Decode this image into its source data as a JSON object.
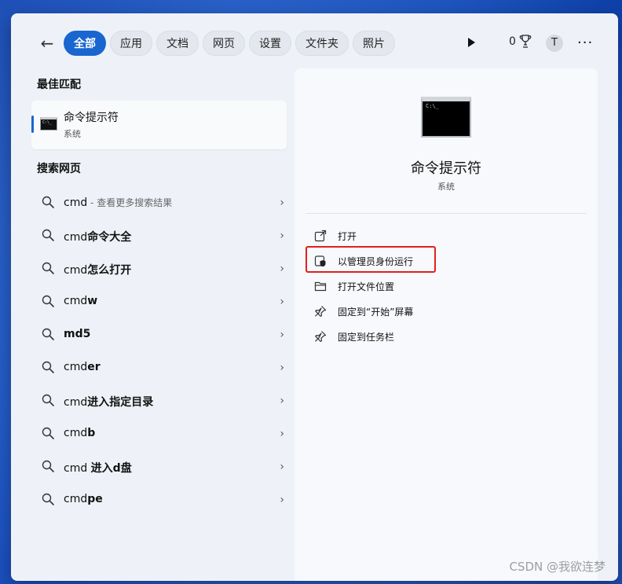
{
  "toolbar": {
    "back_label": "←",
    "filters": [
      "全部",
      "应用",
      "文档",
      "网页",
      "设置",
      "文件夹",
      "照片"
    ],
    "active_filter_index": 0,
    "points": "0",
    "avatar_initial": "T",
    "more_label": "···"
  },
  "best_match": {
    "heading": "最佳匹配",
    "app_name": "命令提示符",
    "app_sub": "系统"
  },
  "web_search": {
    "heading": "搜索网页",
    "results": [
      {
        "plain": "cmd",
        "bold": "",
        "hint": " - 查看更多搜索结果"
      },
      {
        "plain": "cmd",
        "bold": "命令大全",
        "hint": ""
      },
      {
        "plain": "cmd",
        "bold": "怎么打开",
        "hint": ""
      },
      {
        "plain": "cmd",
        "bold": "w",
        "hint": ""
      },
      {
        "plain": "",
        "bold": "md5",
        "hint": ""
      },
      {
        "plain": "cmd",
        "bold": "er",
        "hint": ""
      },
      {
        "plain": "cmd",
        "bold": "进入指定目录",
        "hint": ""
      },
      {
        "plain": "cmd",
        "bold": "b",
        "hint": ""
      },
      {
        "plain": "cmd ",
        "bold": "进入d盘",
        "hint": ""
      },
      {
        "plain": "cmd",
        "bold": "pe",
        "hint": ""
      }
    ]
  },
  "detail": {
    "app_name": "命令提示符",
    "app_sub": "系统",
    "actions": [
      {
        "label": "打开",
        "icon": "open-external-icon"
      },
      {
        "label": "以管理员身份运行",
        "icon": "admin-shield-icon"
      },
      {
        "label": "打开文件位置",
        "icon": "folder-icon"
      },
      {
        "label": "固定到“开始”屏幕",
        "icon": "pin-icon"
      },
      {
        "label": "固定到任务栏",
        "icon": "pin-icon"
      }
    ],
    "highlighted_action_index": 1
  },
  "watermark": "CSDN @我欲连梦",
  "colors": {
    "accent": "#1a66d0",
    "highlight": "#e02020"
  }
}
